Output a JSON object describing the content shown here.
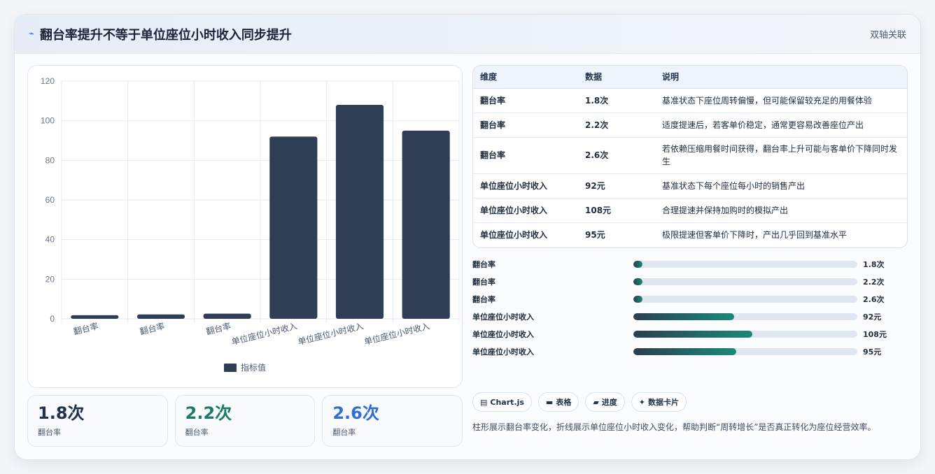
{
  "header": {
    "title": "翻台率提升不等于单位座位小时收入同步提升",
    "tag": "双轴关联"
  },
  "chart_data": {
    "type": "bar",
    "categories": [
      "翻台率",
      "翻台率",
      "翻台率",
      "单位座位小时收入",
      "单位座位小时收入",
      "单位座位小时收入"
    ],
    "series": [
      {
        "name": "指标值",
        "values": [
          1.8,
          2.2,
          2.6,
          92,
          108,
          95
        ]
      }
    ],
    "ylim": [
      0,
      120
    ],
    "yticks": [
      0,
      20,
      40,
      60,
      80,
      100,
      120
    ],
    "bar_color": "#2f3e55",
    "grid": true,
    "legend": "bottom"
  },
  "kpis": [
    {
      "value": "1.8次",
      "label": "翻台率",
      "color": "#22324a"
    },
    {
      "value": "2.2次",
      "label": "翻台率",
      "color": "#1c7a6a"
    },
    {
      "value": "2.6次",
      "label": "翻台率",
      "color": "#2f6fd0"
    }
  ],
  "table": {
    "headers": [
      "维度",
      "数据",
      "说明"
    ],
    "rows": [
      {
        "dim": "翻台率",
        "data": "1.8次",
        "desc": "基准状态下座位周转偏慢，但可能保留较充足的用餐体验"
      },
      {
        "dim": "翻台率",
        "data": "2.2次",
        "desc": "适度提速后，若客单价稳定，通常更容易改善座位产出"
      },
      {
        "dim": "翻台率",
        "data": "2.6次",
        "desc": "若依赖压缩用餐时间获得，翻台率上升可能与客单价下降同时发生"
      },
      {
        "dim": "单位座位小时收入",
        "data": "92元",
        "desc": "基准状态下每个座位每小时的销售产出"
      },
      {
        "dim": "单位座位小时收入",
        "data": "108元",
        "desc": "合理提速并保持加购时的模拟产出"
      },
      {
        "dim": "单位座位小时收入",
        "data": "95元",
        "desc": "极限提速但客单价下降时，产出几乎回到基准水平"
      }
    ]
  },
  "progress": [
    {
      "label": "翻台率",
      "value": "1.8次",
      "fraction": 0.04
    },
    {
      "label": "翻台率",
      "value": "2.2次",
      "fraction": 0.04
    },
    {
      "label": "翻台率",
      "value": "2.6次",
      "fraction": 0.04
    },
    {
      "label": "单位座位小时收入",
      "value": "92元",
      "fraction": 0.45
    },
    {
      "label": "单位座位小时收入",
      "value": "108元",
      "fraction": 0.53
    },
    {
      "label": "单位座位小时收入",
      "value": "95元",
      "fraction": 0.46
    }
  ],
  "chips": [
    {
      "icon": "▤",
      "label": "Chart.js"
    },
    {
      "icon": "▬",
      "label": "表格"
    },
    {
      "icon": "▰",
      "label": "进度"
    },
    {
      "icon": "✦",
      "label": "数据卡片"
    }
  ],
  "note": "柱形展示翻台率变化，折线展示单位座位小时收入变化，帮助判断“周转增长”是否真正转化为座位经营效率。"
}
